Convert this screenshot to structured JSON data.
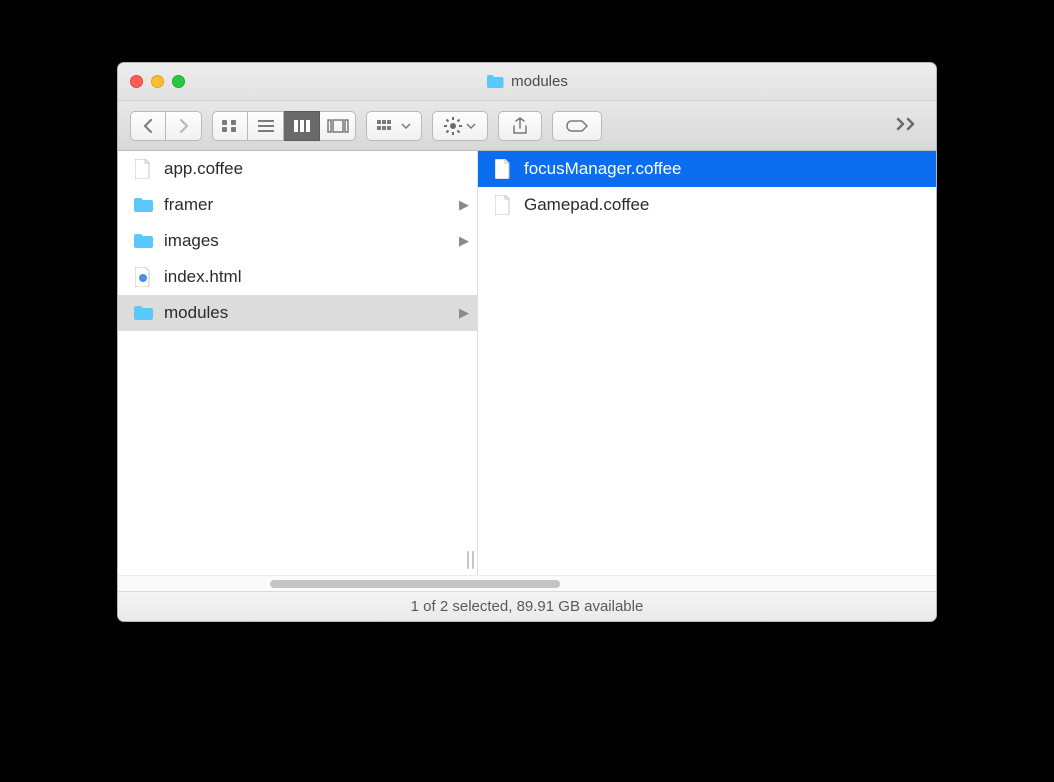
{
  "window": {
    "title": "modules"
  },
  "columns": {
    "left": [
      {
        "name": "app.coffee",
        "type": "file",
        "selected": false,
        "hasChildren": false
      },
      {
        "name": "framer",
        "type": "folder",
        "selected": false,
        "hasChildren": true
      },
      {
        "name": "images",
        "type": "folder",
        "selected": false,
        "hasChildren": true
      },
      {
        "name": "index.html",
        "type": "html",
        "selected": false,
        "hasChildren": false
      },
      {
        "name": "modules",
        "type": "folder",
        "selected": true,
        "hasChildren": true
      }
    ],
    "right": [
      {
        "name": "focusManager.coffee",
        "type": "file",
        "selected": true,
        "hasChildren": false
      },
      {
        "name": "Gamepad.coffee",
        "type": "file",
        "selected": false,
        "hasChildren": false
      }
    ]
  },
  "status": {
    "text": "1 of 2 selected, 89.91 GB available"
  },
  "colors": {
    "selection": "#0b6def",
    "folder": "#5ac8fa"
  }
}
